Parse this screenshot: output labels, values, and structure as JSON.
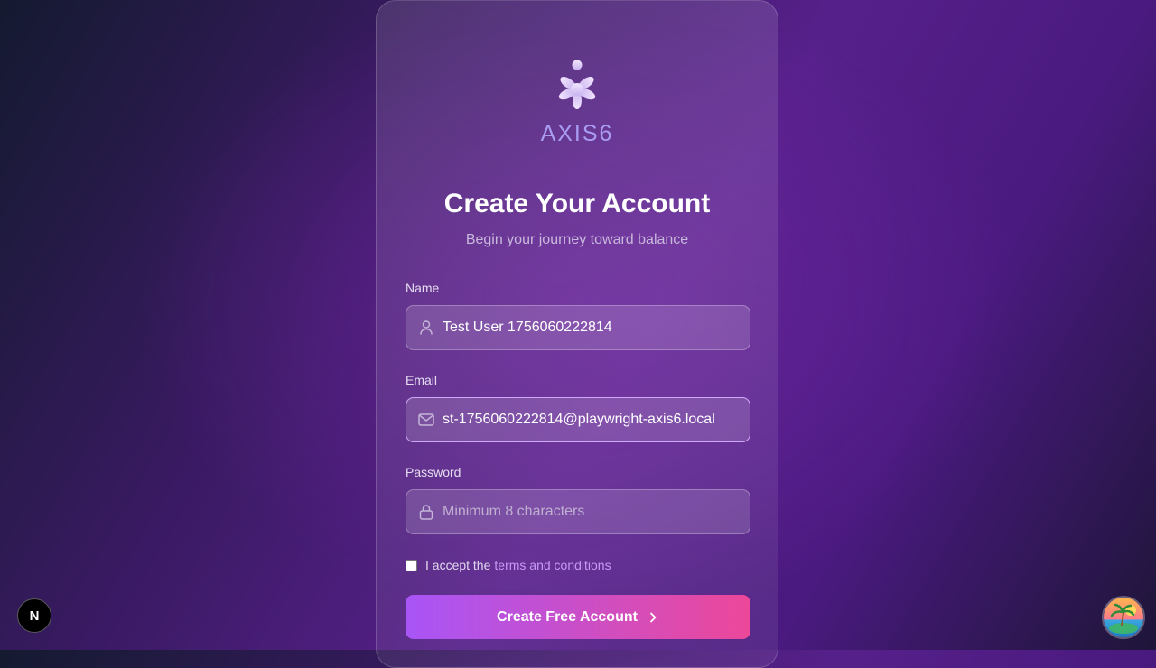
{
  "brand": {
    "name": "AXIS6"
  },
  "header": {
    "title": "Create Your Account",
    "subtitle": "Begin your journey toward balance"
  },
  "form": {
    "name": {
      "label": "Name",
      "value": "Test User 1756060222814",
      "icon": "user-icon"
    },
    "email": {
      "label": "Email",
      "value": "st-1756060222814@playwright-axis6.local",
      "icon": "mail-icon"
    },
    "password": {
      "label": "Password",
      "value": "",
      "placeholder": "Minimum 8 characters",
      "icon": "lock-icon"
    },
    "terms": {
      "prefix": "I accept the",
      "link": "terms and conditions",
      "checked": false
    },
    "submit_label": "Create Free Account"
  },
  "dev_badge": {
    "letter": "N"
  },
  "colors": {
    "accent_start": "#a855f7",
    "accent_end": "#ec4899",
    "brand_text": "#a99cf2",
    "link": "#c79bf5"
  }
}
